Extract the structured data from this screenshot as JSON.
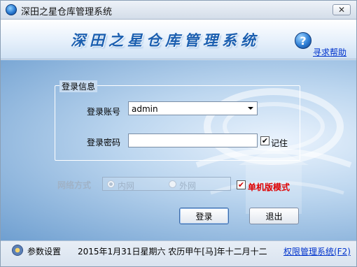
{
  "window": {
    "title": "深田之星仓库管理系统",
    "close_glyph": "✕"
  },
  "banner": {
    "title": "深田之星仓库管理系统",
    "help_label": "寻求帮助"
  },
  "login": {
    "group_title": "登录信息",
    "account_label": "登录账号",
    "account_value": "admin",
    "password_label": "登录密码",
    "password_value": "",
    "remember_label": "记住",
    "remember_checked": true
  },
  "network": {
    "label": "网络方式",
    "options": [
      "内网",
      "外网"
    ],
    "selected": "内网",
    "standalone_label": "单机版模式",
    "standalone_checked": true
  },
  "buttons": {
    "login": "登录",
    "exit": "退出"
  },
  "status": {
    "settings_label": "参数设置",
    "date_text": "2015年1月31日星期六 农历甲午[马]年十二月十二",
    "rights_link": "权限管理系统(F2)"
  },
  "colors": {
    "banner_title": "#1b5fb0",
    "link": "#0033cc",
    "standalone": "#e00000"
  }
}
